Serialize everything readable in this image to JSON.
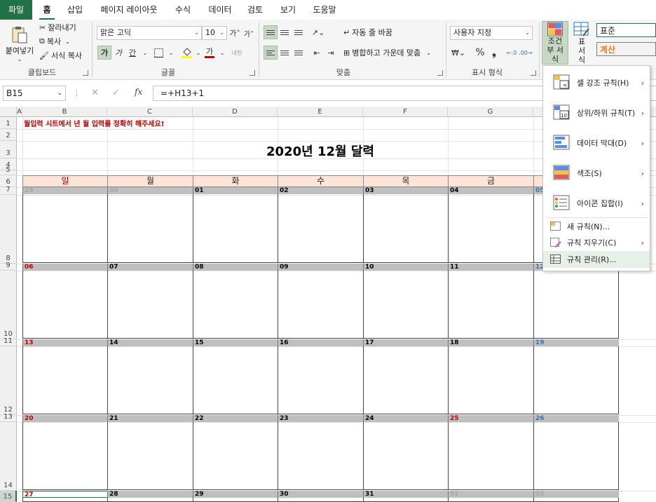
{
  "tabs": [
    "파일",
    "홈",
    "삽입",
    "페이지 레이아웃",
    "수식",
    "데이터",
    "검토",
    "보기",
    "도움말"
  ],
  "ribbon": {
    "clipboard": {
      "paste": "붙여넣기",
      "cut": "잘라내기",
      "copy": "복사",
      "format_painter": "서식 복사",
      "label": "클립보드"
    },
    "font": {
      "name": "맑은 고딕",
      "size": "10",
      "grow": "가˄",
      "shrink": "가˅",
      "bold": "가",
      "italic": "가",
      "underline": "간",
      "color_letter": "가",
      "phonetic": "내천",
      "label": "글꼴"
    },
    "align": {
      "wrap": "자동 줄 바꿈",
      "merge": "병합하고 가운데 맞춤",
      "label": "맞춤"
    },
    "number": {
      "format": "사용자 지정",
      "percent": "%",
      "comma": "❟",
      "label": "표시 형식"
    },
    "styles": {
      "conditional": "조건부 서식",
      "table": "표 서식",
      "normal": "표준",
      "calc": "계산"
    }
  },
  "namebox": "B15",
  "formula": "=+H13+1",
  "columns": [
    "A",
    "B",
    "C",
    "D",
    "E",
    "F",
    "G"
  ],
  "sheet": {
    "notice": "월입력 시트에서 년 월 입력를 정확히 해주세요!",
    "title": "2020년 12월 달력",
    "days": [
      "일",
      "월",
      "화",
      "수",
      "목",
      "금"
    ],
    "weeks": [
      [
        "29",
        "30",
        "01",
        "02",
        "03",
        "04",
        "05"
      ],
      [
        "06",
        "07",
        "08",
        "09",
        "10",
        "11",
        "12"
      ],
      [
        "13",
        "14",
        "15",
        "16",
        "17",
        "18",
        "19"
      ],
      [
        "20",
        "21",
        "22",
        "23",
        "24",
        "25",
        "26"
      ],
      [
        "27",
        "28",
        "29",
        "30",
        "31",
        "01",
        "02"
      ]
    ],
    "row_numbers": [
      "1",
      "2",
      "3",
      "4",
      "5",
      "6",
      "7",
      "8",
      "9",
      "10",
      "11",
      "12",
      "13",
      "14",
      "15"
    ]
  },
  "menu": {
    "items": [
      "셀 강조 규칙(H)",
      "상위/하위 규칙(T)",
      "데이터 막대(D)",
      "색조(S)",
      "아이콘 집합(I)",
      "새 규칙(N)...",
      "규칙 지우기(C)",
      "규칙 관리(R)..."
    ]
  },
  "colors": {
    "accent": "#217346",
    "sunday": "#c00000",
    "saturday": "#2e75b6",
    "holiday": "#c00000",
    "header_fill": "#fce4d6",
    "out_month": "#a6a6a6"
  }
}
